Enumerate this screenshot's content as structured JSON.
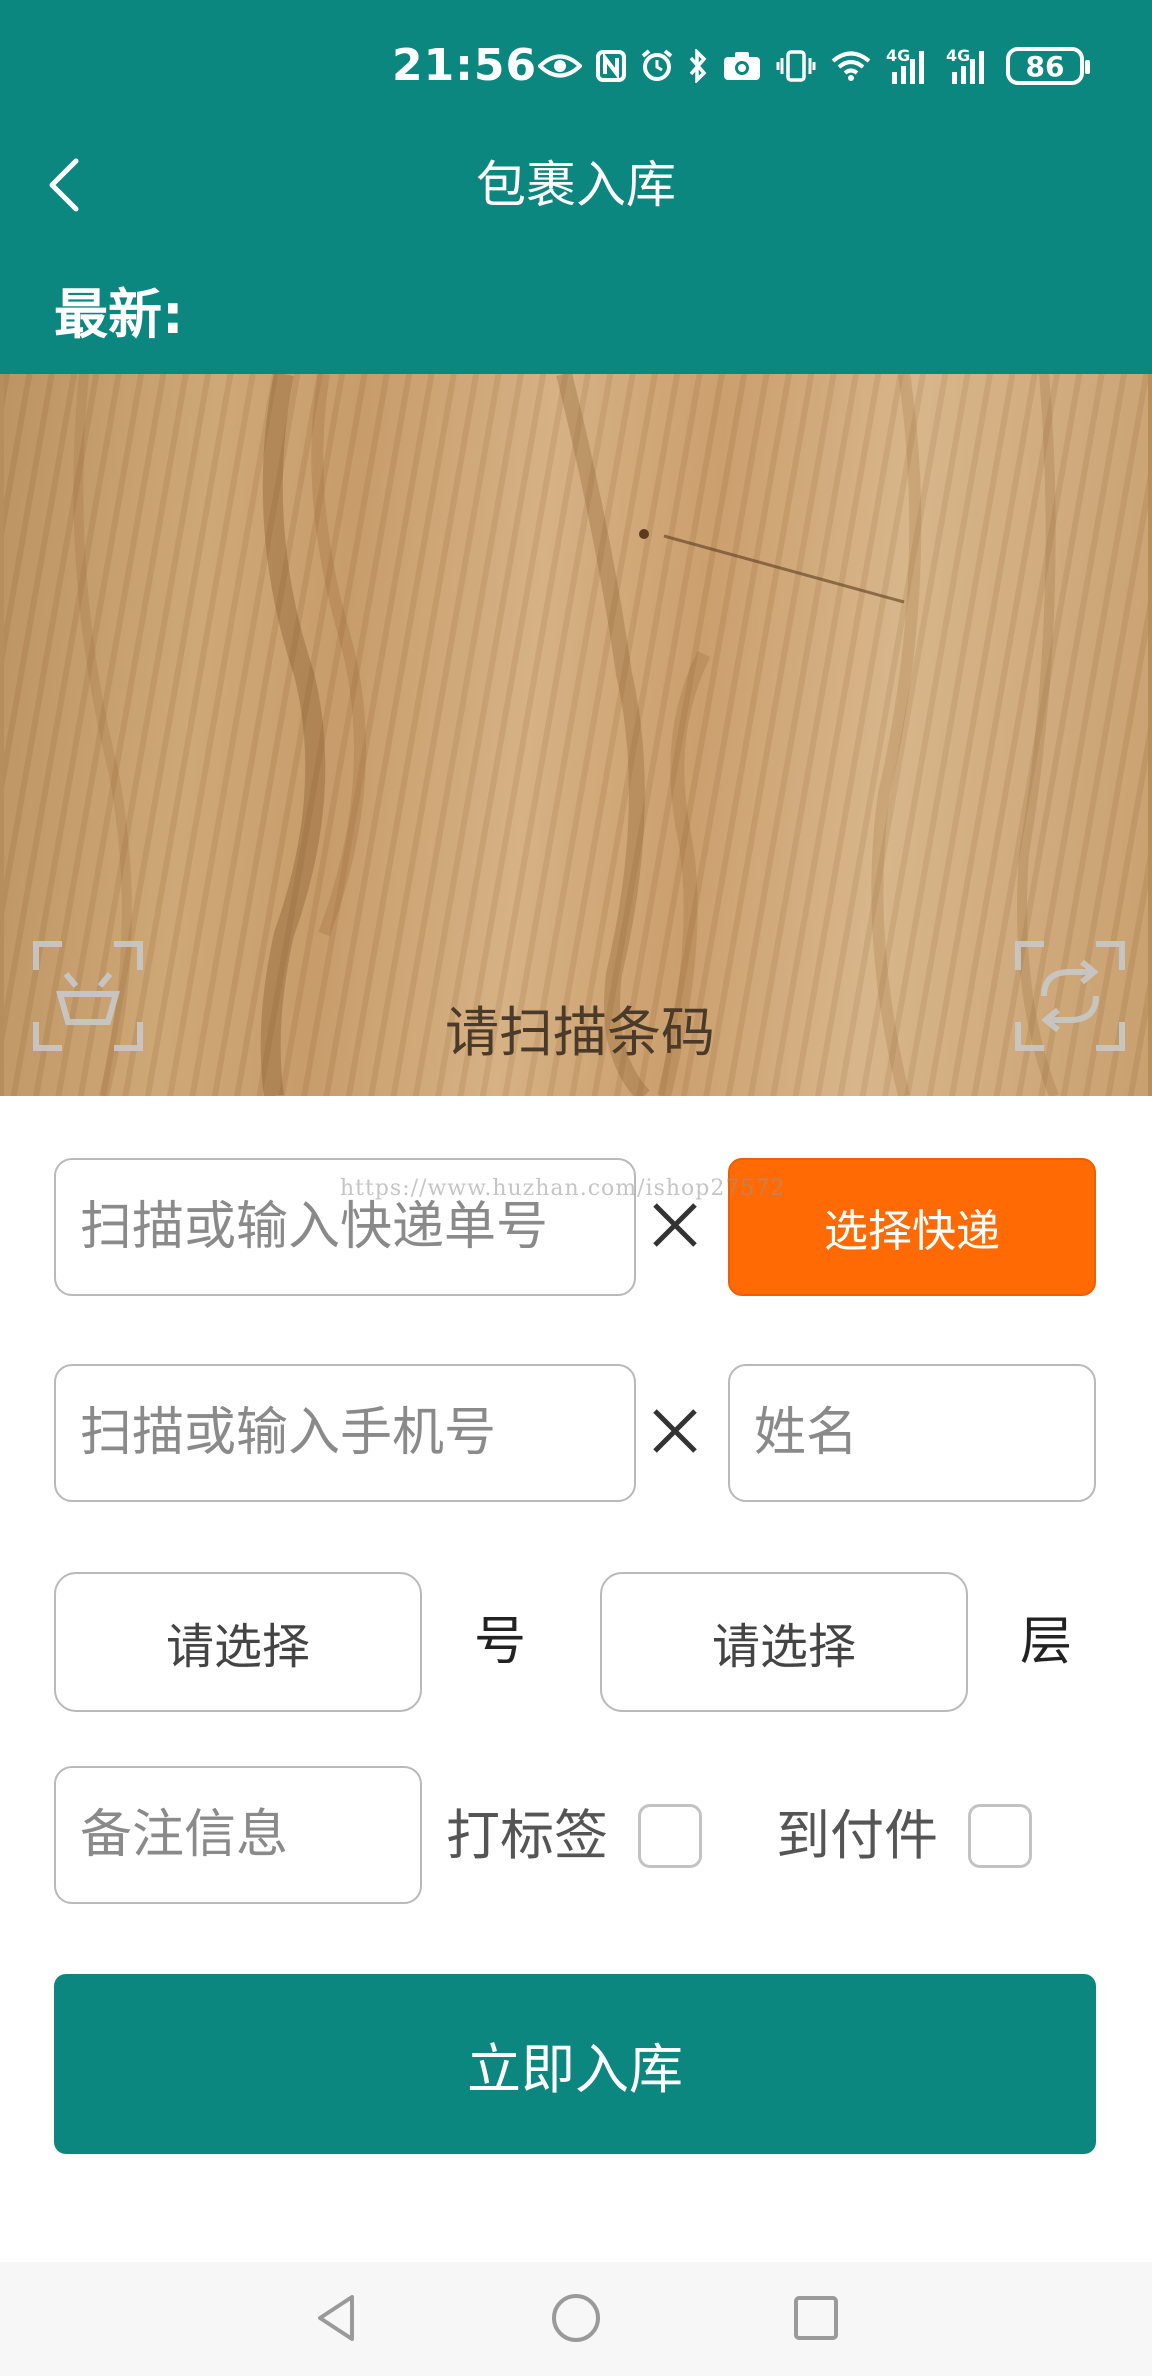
{
  "status_bar": {
    "time": "21:56",
    "icons": [
      "eye-icon",
      "nfc-icon",
      "alarm-icon",
      "bluetooth-icon",
      "camera-icon",
      "vibrate-icon",
      "wifi-icon",
      "signal-4g-icon",
      "signal-4g-icon",
      "battery-icon"
    ],
    "network_label_1": "4G",
    "network_label_2": "4G",
    "battery_level": "86"
  },
  "header": {
    "title": "包裹入库",
    "latest_label": "最新:",
    "background_color": "#0b8780"
  },
  "camera": {
    "scan_hint": "请扫描条码",
    "left_button_icon": "scan-frame-icon",
    "right_button_icon": "switch-camera-icon"
  },
  "form": {
    "tracking_placeholder": "扫描或输入快递单号",
    "tracking_value": "",
    "select_courier_label": "选择快递",
    "select_courier_color": "#ff6a05",
    "phone_placeholder": "扫描或输入手机号",
    "phone_value": "",
    "name_placeholder": "姓名",
    "name_value": "",
    "number_select_label": "请选择",
    "number_unit": "号",
    "floor_select_label": "请选择",
    "floor_unit": "层",
    "remarks_placeholder": "备注信息",
    "print_label_text": "打标签",
    "print_label_checked": false,
    "cod_text": "到付件",
    "cod_checked": false,
    "submit_label": "立即入库"
  },
  "watermark": "https://www.huzhan.com/ishop27572",
  "nav_bar": {
    "icons": [
      "nav-back-icon",
      "nav-home-icon",
      "nav-recent-icon"
    ]
  }
}
